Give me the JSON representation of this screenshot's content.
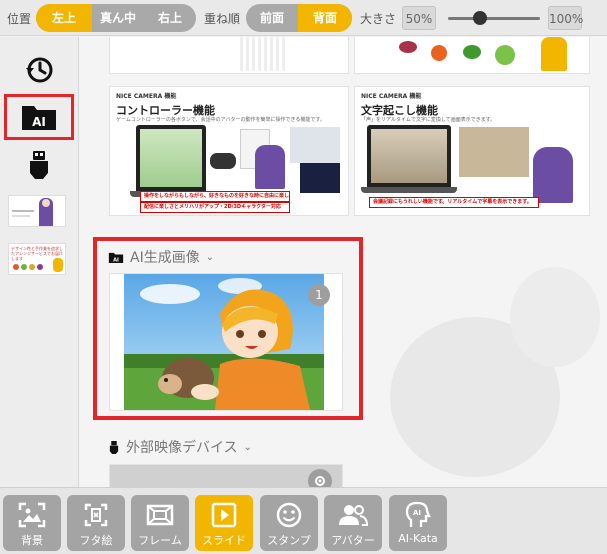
{
  "toolbar": {
    "position_label": "位置",
    "position_options": [
      "左上",
      "真ん中",
      "右上"
    ],
    "order_label": "重ね順",
    "order_options": [
      "前面",
      "背面"
    ],
    "size_label": "大きさ",
    "size_min": "50%",
    "size_max": "100%",
    "size_value_fraction": 0.35
  },
  "sidebar": {
    "thumb_text": "デザイン性と手作業を追求したアレンジサービスでお届けします"
  },
  "cards": {
    "controller": {
      "brand": "NICE CAMERA 機能",
      "title": "コントローラー機能",
      "desc": "ゲームコントローラーの各ボタンで、会話中のアバターの動作を簡単に操作できる機能です。",
      "banner1": "操作をしながらもしながら、好きなものを好きな時に自由に楽しめます！",
      "banner2": "配信に楽しさとメリハリがアップ・2D/3Dキャラクター対応"
    },
    "transcribe": {
      "brand": "NICE CAMERA 機能",
      "title": "文字起こし機能",
      "desc": "「声」をリアルタイムで文字に変換して画面表示できます。",
      "banner1": "会議記録にもうれしい機能です。リアルタイムで字幕を表示できます。"
    }
  },
  "sections": {
    "ai": {
      "label": "AI生成画像",
      "count": "1"
    },
    "external": {
      "label": "外部映像デバイス"
    }
  },
  "nav": [
    {
      "label": "背景"
    },
    {
      "label": "フタ絵"
    },
    {
      "label": "フレーム"
    },
    {
      "label": "スライド"
    },
    {
      "label": "スタンプ"
    },
    {
      "label": "アバター"
    },
    {
      "label": "AI-Kata"
    }
  ],
  "colors": {
    "accent": "#f2b600",
    "highlight": "#e3262b",
    "inactive": "#a4a4a4"
  },
  "icons": {
    "history": "history-icon",
    "ai": "ai-folder-icon",
    "usb": "usb-device-icon",
    "settings": "gear-icon"
  }
}
